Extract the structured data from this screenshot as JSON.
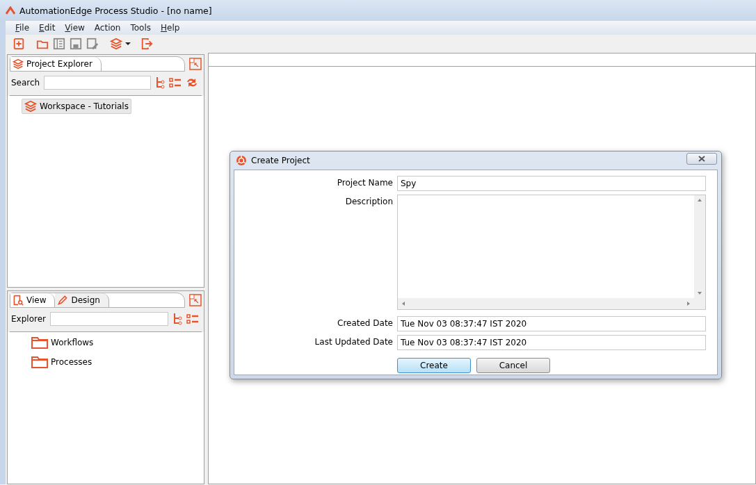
{
  "window": {
    "title": "AutomationEdge Process Studio - [no name]"
  },
  "menu": [
    {
      "label": "File",
      "underlined": true
    },
    {
      "label": "Edit",
      "underlined": true
    },
    {
      "label": "View",
      "underlined": true
    },
    {
      "label": "Action",
      "underlined": false
    },
    {
      "label": "Tools",
      "underlined": false
    },
    {
      "label": "Help",
      "underlined": true
    }
  ],
  "toolbar": [
    {
      "kind": "new",
      "disabled": false
    },
    {
      "kind": "open",
      "disabled": false
    },
    {
      "kind": "list",
      "disabled": true
    },
    {
      "kind": "save",
      "disabled": true
    },
    {
      "kind": "edit",
      "disabled": true
    },
    {
      "kind": "layers",
      "disabled": false
    },
    {
      "kind": "exit",
      "disabled": false
    }
  ],
  "project_panel": {
    "tabs": [
      {
        "label": "Project Explorer",
        "kind": "layers",
        "selected": true
      }
    ],
    "search_label": "Search",
    "tree": [
      {
        "label": "Workspace - Tutorials",
        "selected": true
      }
    ]
  },
  "view_panel": {
    "tabs": [
      {
        "label": "View",
        "kind": "view",
        "selected": true
      },
      {
        "label": "Design",
        "kind": "design",
        "selected": false
      }
    ],
    "search_label": "Explorer",
    "tree": [
      {
        "label": "Workflows",
        "selected": false
      },
      {
        "label": "Processes",
        "selected": false
      }
    ]
  },
  "dialog": {
    "title": "Create Project",
    "fields": [
      {
        "label": "Project Name",
        "value": "Spy",
        "kind": "text"
      },
      {
        "label": "Description",
        "kind": "area"
      },
      {
        "label": "Created Date",
        "value": "Tue Nov 03 08:37:47 IST 2020",
        "kind": "text"
      },
      {
        "label": "Last Updated Date",
        "value": "Tue Nov 03 08:37:47 IST 2020",
        "kind": "text"
      }
    ],
    "buttons": [
      {
        "label": "Create",
        "selected": true
      },
      {
        "label": "Cancel",
        "selected": false
      }
    ]
  }
}
